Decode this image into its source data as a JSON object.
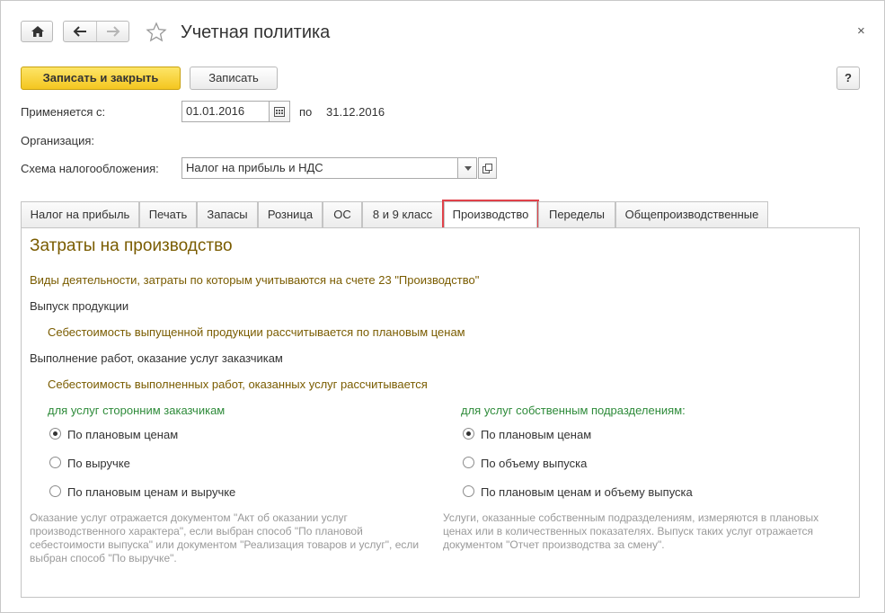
{
  "window": {
    "title": "Учетная политика",
    "close_glyph": "×"
  },
  "toolbar": {
    "save_close_label": "Записать и закрыть",
    "save_label": "Записать",
    "help_label": "?"
  },
  "form": {
    "applies_from_label": "Применяется с:",
    "applies_from_value": "01.01.2016",
    "to_label": "по",
    "to_value": "31.12.2016",
    "organization_label": "Организация:",
    "tax_scheme_label": "Схема налогообложения:",
    "tax_scheme_value": "Налог на прибыль и НДС"
  },
  "tabs": [
    {
      "label": "Налог на прибыль"
    },
    {
      "label": "Печать"
    },
    {
      "label": "Запасы"
    },
    {
      "label": "Розница"
    },
    {
      "label": "ОС"
    },
    {
      "label": "8 и 9 класс"
    },
    {
      "label": "Производство",
      "active": true
    },
    {
      "label": "Переделы"
    },
    {
      "label": "Общепроизводственные"
    }
  ],
  "content": {
    "title": "Затраты на производство",
    "activities_note": "Виды деятельности, затраты по которым учитываются на счете 23 \"Производство\"",
    "output_heading": "Выпуск продукции",
    "output_note": "Себестоимость выпущенной продукции рассчитывается по плановым ценам",
    "works_heading": "Выполнение работ, оказание услуг заказчикам",
    "works_note": "Себестоимость выполненных работ, оказанных услуг рассчитывается",
    "external": {
      "heading": "для услуг сторонним заказчикам",
      "options": [
        "По плановым ценам",
        "По выручке",
        "По плановым ценам и выручке"
      ],
      "selected": 0,
      "note": "Оказание услуг отражается документом \"Акт об оказании услуг производственного характера\", если выбран способ \"По плановой себестоимости выпуска\" или документом \"Реализация товаров и услуг\", если выбран способ \"По выручке\"."
    },
    "internal": {
      "heading": "для услуг собственным подразделениям:",
      "options": [
        "По плановым ценам",
        "По объему выпуска",
        "По плановым ценам и объему выпуска"
      ],
      "selected": 0,
      "note": "Услуги, оказанные собственным подразделениям, измеряются в плановых ценах или в количественных показателях. Выпуск таких услуг отражается документом \"Отчет производства за смену\"."
    }
  },
  "colors": {
    "primary_button": "#f4c620",
    "section_text": "#7a5c00",
    "green_text": "#2e8b3a",
    "active_tab_highlight": "#e0424a"
  }
}
